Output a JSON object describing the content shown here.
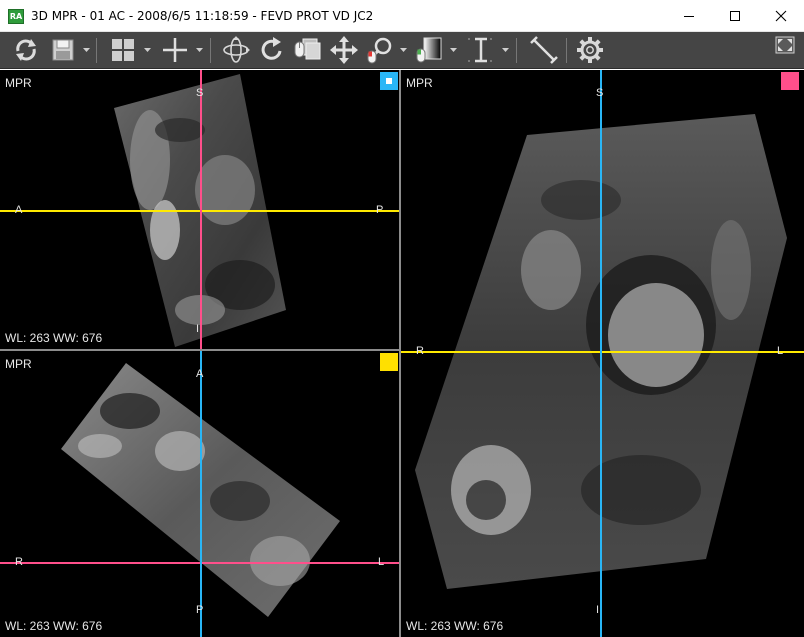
{
  "window": {
    "title": "3D MPR - 01 AC - 2008/6/5 11:18:59 - FEVD PROT VD JC2",
    "app_icon_text": "RA",
    "controls": [
      "minimize",
      "maximize",
      "close"
    ]
  },
  "toolbar": {
    "tools": [
      {
        "id": "reset",
        "icon": "rotate-reset-icon"
      },
      {
        "id": "save",
        "icon": "save-icon"
      },
      {
        "id": "layout",
        "icon": "layout-grid-icon"
      },
      {
        "id": "crosshair",
        "icon": "crosshair-icon"
      },
      {
        "id": "rotate3d",
        "icon": "rotate3d-icon"
      },
      {
        "id": "rotate",
        "icon": "rotate-icon"
      },
      {
        "id": "mouse-stack",
        "icon": "mouse-stack-icon"
      },
      {
        "id": "pan",
        "icon": "pan-icon"
      },
      {
        "id": "zoom",
        "icon": "zoom-icon"
      },
      {
        "id": "window-level",
        "icon": "window-level-icon"
      },
      {
        "id": "thickness",
        "icon": "slab-thickness-icon"
      },
      {
        "id": "measure",
        "icon": "ruler-icon"
      },
      {
        "id": "settings",
        "icon": "gear-icon"
      },
      {
        "id": "fullscreen",
        "icon": "fullscreen-icon"
      }
    ]
  },
  "viewports": {
    "top_left": {
      "label": "MPR",
      "window_level": "WL: 263 WW: 676",
      "orient_top": "S",
      "orient_bottom": "I",
      "orient_left": "A",
      "orient_right": "P",
      "swatch_color": "#29b6f6",
      "h_line_color": "#ffea00",
      "v_line_color": "#ff4f8b"
    },
    "bottom_left": {
      "label": "MPR",
      "window_level": "WL: 263 WW: 676",
      "orient_top": "A",
      "orient_bottom": "P",
      "orient_left": "R",
      "orient_right": "L",
      "swatch_color": "#ffe000",
      "h_line_color": "#ff4f8b",
      "v_line_color": "#29b6f6"
    },
    "right": {
      "label": "MPR",
      "window_level": "WL: 263 WW: 676",
      "orient_top": "S",
      "orient_bottom": "I",
      "orient_left": "R",
      "orient_right": "L",
      "swatch_color": "#ff4f8b",
      "h_line_color": "#ffea00",
      "v_line_color": "#29b6f6"
    }
  },
  "colors": {
    "toolbar_bg": "#454545",
    "viewport_bg": "#000000",
    "divider": "#8c8c8c",
    "overlay_text": "#e6e6e6"
  }
}
